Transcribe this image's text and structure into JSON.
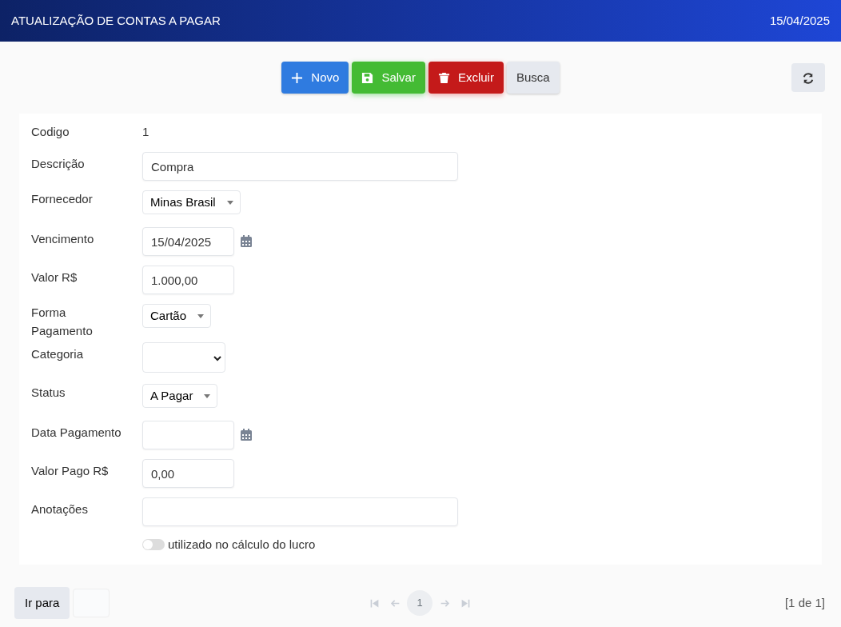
{
  "header": {
    "title": "ATUALIZAÇÃO DE CONTAS A PAGAR",
    "date": "15/04/2025"
  },
  "toolbar": {
    "buttons": [
      {
        "label": "Novo",
        "kind": "new"
      },
      {
        "label": "Salvar",
        "kind": "save"
      },
      {
        "label": "Excluir",
        "kind": "delete"
      },
      {
        "label": "Busca",
        "kind": "search"
      }
    ]
  },
  "form": {
    "fields": [
      {
        "label": "Codigo",
        "kind": "static",
        "value": "1"
      },
      {
        "label": "Descrição",
        "kind": "text",
        "value": "Compra"
      },
      {
        "label": "Fornecedor",
        "kind": "dropdown",
        "value": "Minas Brasil"
      },
      {
        "label": "Vencimento",
        "kind": "date",
        "value": "15/04/2025"
      },
      {
        "label": "Valor R$",
        "kind": "money",
        "value": "1.000,00"
      },
      {
        "label": "Forma Pagamento",
        "kind": "dropdown",
        "value": "Cartão"
      },
      {
        "label": "Categoria",
        "kind": "select"
      },
      {
        "label": "Status",
        "kind": "dropdown",
        "value": "A Pagar"
      },
      {
        "label": "Data Pagamento",
        "kind": "date"
      },
      {
        "label": "Valor Pago R$",
        "kind": "money",
        "value": "0,00"
      },
      {
        "label": "Anotações",
        "kind": "text"
      },
      {
        "label": "utilizado no cálculo do lucro",
        "kind": "toggle",
        "on": false
      }
    ]
  },
  "footer": {
    "goto_label": "Ir para",
    "pager": {
      "page": "1",
      "disabled": true
    },
    "page_info": "[1 de 1]"
  }
}
